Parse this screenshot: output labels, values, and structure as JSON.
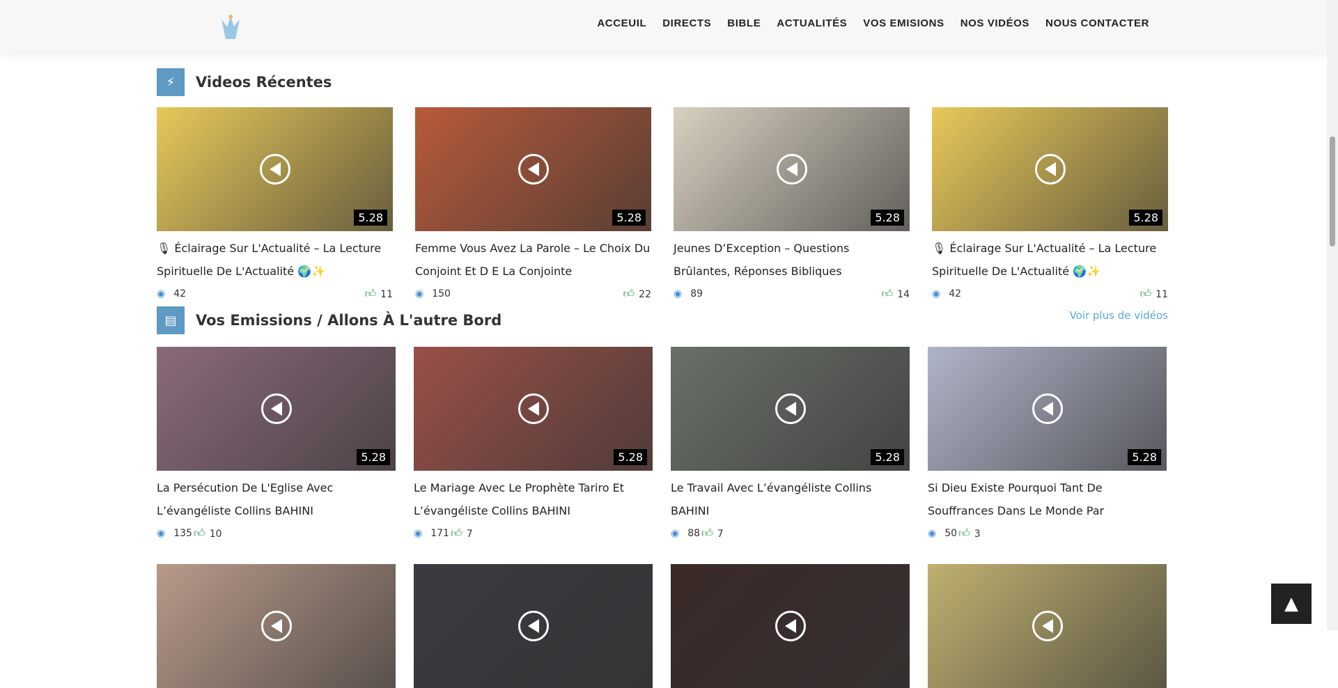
{
  "nav": [
    "ACCEUIL",
    "DIRECTS",
    "BIBLE",
    "ACTUALITÉS",
    "VOS EMISIONS",
    "NOS VIDÉOS",
    "NOUS CONTACTER"
  ],
  "recent": {
    "title": "Videos Récentes",
    "icon": "bolt-icon",
    "videos": [
      {
        "title": "🎙 Éclairage Sur L'Actualité – La Lecture Spirituelle De L'Actualité 🌍✨",
        "views": "42",
        "likes": "11",
        "duration": "5.28",
        "color": "#e8c85a"
      },
      {
        "title": "Femme Vous Avez La Parole – Le Choix Du Conjoint Et D E La Conjointe",
        "views": "150",
        "likes": "22",
        "duration": "5.28",
        "color": "#b85a3a"
      },
      {
        "title": "Jeunes D’Exception – Questions Brûlantes, Réponses Bibliques",
        "views": "89",
        "likes": "14",
        "duration": "5.28",
        "color": "#d8d0c0"
      },
      {
        "title": "🎙 Éclairage Sur L'Actualité – La Lecture Spirituelle De L'Actualité 🌍✨",
        "views": "42",
        "likes": "11",
        "duration": "5.28",
        "color": "#e8c85a"
      }
    ]
  },
  "emissions": {
    "title": "Vos Emissions / Allons À L'autre Bord",
    "icon": "book-icon",
    "more": "Voir plus de vidéos",
    "videos": [
      {
        "title": "La Persécution De L'Eglise Avec L’évangéliste Collins BAHINI",
        "views": "135",
        "likes": "10",
        "duration": "5.28",
        "color": "#8a6a7a"
      },
      {
        "title": "Le Mariage Avec Le Prophète Tariro Et L’évangéliste Collins BAHINI",
        "views": "171",
        "likes": "7",
        "duration": "5.28",
        "color": "#9a5048"
      },
      {
        "title": "Le Travail Avec L’évangéliste Collins BAHINI",
        "views": "88",
        "likes": "7",
        "duration": "5.28",
        "color": "#6a7068"
      },
      {
        "title": "Si Dieu Existe Pourquoi Tant De Souffrances Dans Le Monde Par",
        "views": "50",
        "likes": "3",
        "duration": "5.28",
        "color": "#b0b4c8"
      }
    ]
  },
  "row3_colors": [
    "#b89a8a",
    "#3a3a40",
    "#3a2a28",
    "#c0b070"
  ]
}
